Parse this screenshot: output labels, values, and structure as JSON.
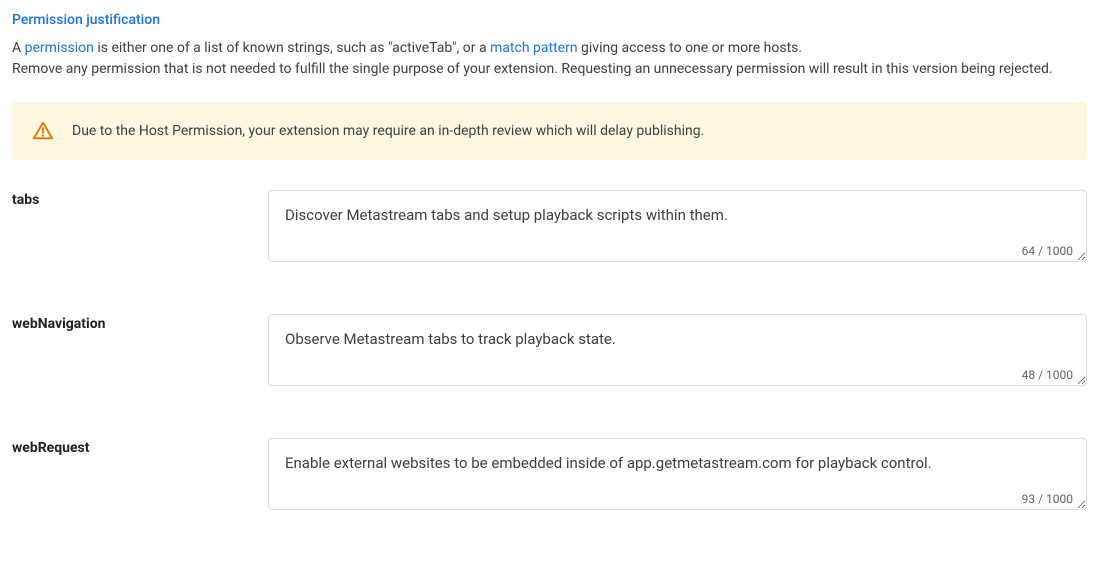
{
  "section": {
    "title": "Permission justification",
    "desc_part1": "A ",
    "desc_link1": "permission",
    "desc_part2": " is either one of a list of known strings, such as \"activeTab\", or a ",
    "desc_link2": "match pattern",
    "desc_part3": " giving access to one or more hosts.",
    "desc_line2": "Remove any permission that is not needed to fulfill the single purpose of your extension. Requesting an unnecessary permission will result in this version being rejected."
  },
  "warning": {
    "text": "Due to the Host Permission, your extension may require an in-depth review which will delay publishing."
  },
  "permissions": [
    {
      "label": "tabs",
      "value": "Discover Metastream tabs and setup playback scripts within them.",
      "count": "64 / 1000"
    },
    {
      "label": "webNavigation",
      "value": "Observe Metastream tabs to track playback state.",
      "count": "48 / 1000"
    },
    {
      "label": "webRequest",
      "value": "Enable external websites to be embedded inside of app.getmetastream.com for playback control.",
      "count": "93 / 1000"
    }
  ]
}
